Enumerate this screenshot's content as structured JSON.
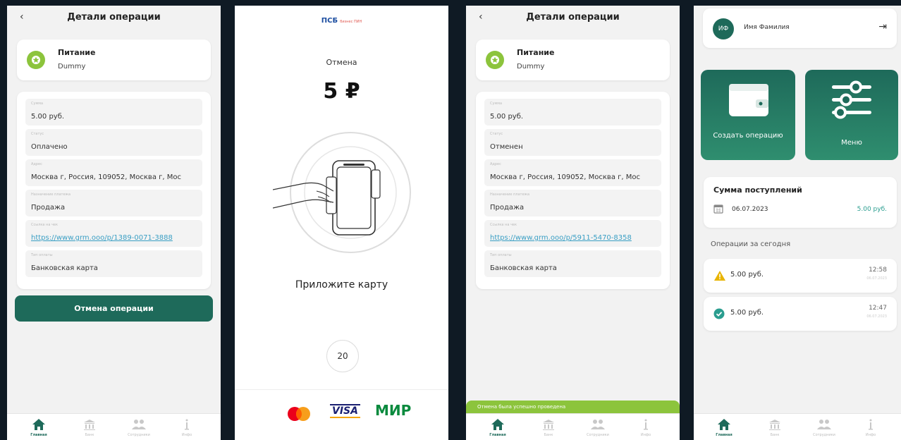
{
  "tabs": [
    {
      "label": "Главная",
      "icon": "home-icon"
    },
    {
      "label": "Банк",
      "icon": "bank-icon"
    },
    {
      "label": "Сотрудники",
      "icon": "employees-icon"
    },
    {
      "label": "Инфо",
      "icon": "info-icon"
    }
  ],
  "details_cancel": {
    "title": "Детали операции",
    "category_title": "Питание",
    "category_sub": "Dummy",
    "fields": [
      {
        "label": "Сумма",
        "value": "5.00 руб."
      },
      {
        "label": "Статус",
        "value": "Оплачено"
      },
      {
        "label": "Адрес",
        "value": "Москва г, Россия, 109052, Москва г, Мос"
      },
      {
        "label": "Назначение платежа",
        "value": "Продажа"
      },
      {
        "label": "Ссылка на чек",
        "value": "https://www.grm.ooo/p/1389-0071-3888"
      },
      {
        "label": "Тип оплаты",
        "value": "Банковская карта"
      }
    ],
    "cancel_button": "Отмена операции"
  },
  "payment": {
    "logo": "ПСБ",
    "logo_sub": "бизнес ПИН",
    "status": "Отмена",
    "amount": "5 ₽",
    "instruction": "Приложите карту",
    "timer": "20",
    "brands": {
      "visa": "VISA",
      "mir": "МИР"
    }
  },
  "details_cancelled": {
    "title": "Детали операции",
    "category_title": "Питание",
    "category_sub": "Dummy",
    "fields": [
      {
        "label": "Сумма",
        "value": "5.00 руб."
      },
      {
        "label": "Статус",
        "value": "Отменен"
      },
      {
        "label": "Адрес",
        "value": "Москва г, Россия, 109052, Москва г, Мос"
      },
      {
        "label": "Назначение платежа",
        "value": "Продажа"
      },
      {
        "label": "Ссылка на чек",
        "value": "https://www.grm.ooo/p/5911-5470-8358"
      },
      {
        "label": "Тип оплаты",
        "value": "Банковская карта"
      }
    ],
    "toast": "Отмена была успешно проведена"
  },
  "dashboard": {
    "avatar": "ИФ",
    "user_name": "Имя Фамилия",
    "create_label": "Создать операцию",
    "menu_label": "Меню",
    "income_title": "Сумма поступлений",
    "income_date": "06.07.2023",
    "income_sum": "5.00 руб.",
    "today_title": "Операции за сегодня",
    "operations": [
      {
        "amount": "5.00 руб.",
        "time": "12:58",
        "date": "06.07.2023",
        "status": "warning"
      },
      {
        "amount": "5.00 руб.",
        "time": "12:47",
        "date": "06.07.2023",
        "status": "success"
      }
    ]
  },
  "colors": {
    "brand": "#1e6a5a",
    "accent_green": "#8cc43c",
    "link": "#3a9fc4",
    "warning": "#e8b400"
  }
}
